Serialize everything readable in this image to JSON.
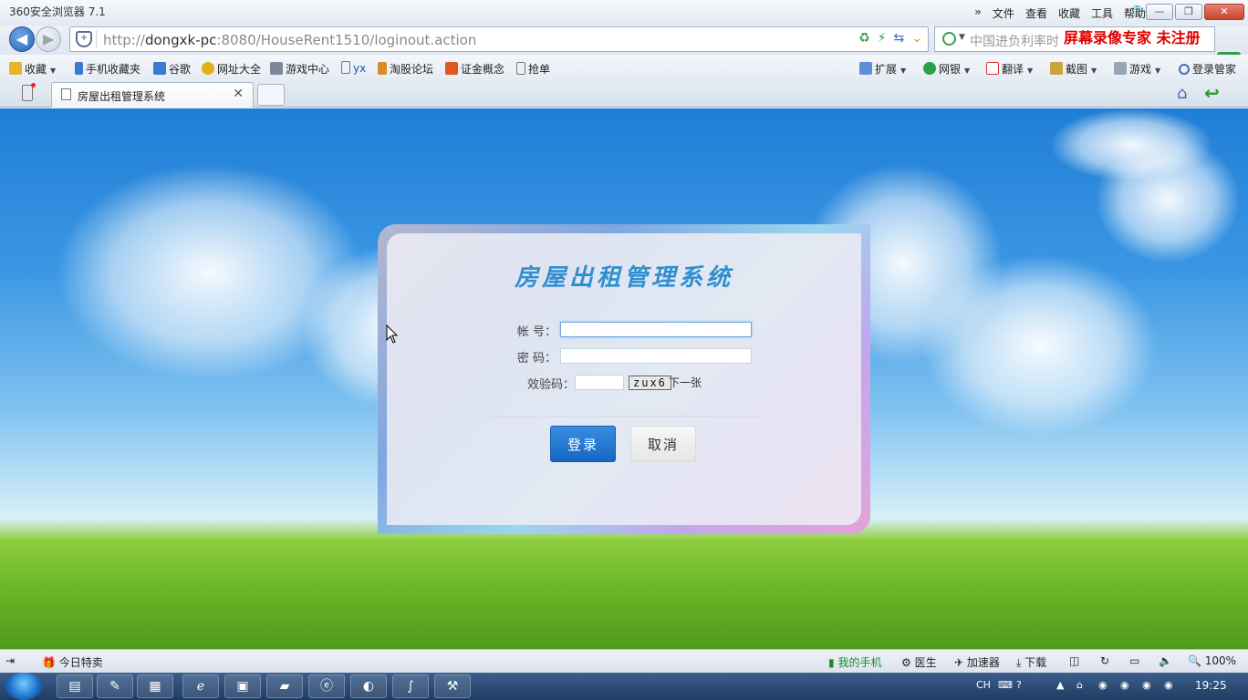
{
  "window": {
    "title": "360安全浏览器 7.1",
    "menu": [
      "文件",
      "查看",
      "收藏",
      "工具",
      "帮助"
    ]
  },
  "address": {
    "url_prefix": "http://",
    "url_host": "dongxk-pc",
    "url_rest": ":8080/HouseRent1510/loginout.action",
    "search_placeholder": "中国进负利率时",
    "recorder_watermark": "屏幕录像专家  未注册"
  },
  "bookmarks": {
    "left": [
      "收藏",
      "手机收藏夹",
      "谷歌",
      "网址大全",
      "游戏中心",
      "yx",
      "淘股论坛",
      "证金概念",
      "抢单"
    ],
    "right": [
      "扩展",
      "网银",
      "翻译",
      "截图",
      "游戏",
      "登录管家"
    ]
  },
  "tab": {
    "label": "房屋出租管理系统"
  },
  "login": {
    "title": "房屋出租管理系统",
    "account_label": "帐  号：",
    "password_label": "密  码：",
    "captcha_label": "效验码：",
    "captcha_text": "zux6",
    "next_label": "下一张",
    "login_button": "登录",
    "cancel_button": "取消"
  },
  "statusbar": {
    "left": "今日特卖",
    "items": [
      "我的手机",
      "医生",
      "加速器",
      "下载"
    ],
    "zoom": "100%"
  },
  "taskbar": {
    "lang": "CH",
    "time": "19:25"
  }
}
